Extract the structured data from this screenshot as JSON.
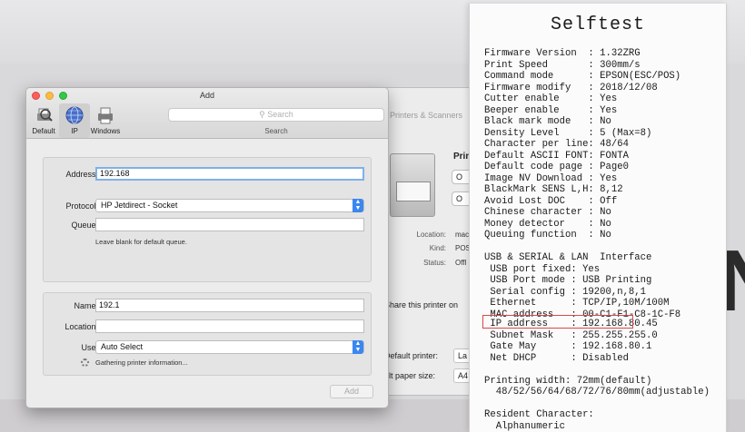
{
  "background_letter": "N",
  "printers_scanners": {
    "title": "Printers & Scanners",
    "printer_name": "Prin",
    "btn1": "O",
    "btn2": "O",
    "rows": [
      {
        "key": "Location:",
        "value": "mac"
      },
      {
        "key": "Kind:",
        "value": "POS"
      },
      {
        "key": "Status:",
        "value": "Offl"
      }
    ],
    "share_text": "Share this printer on",
    "default_printer_label": "Default printer:",
    "default_printer_value": "La",
    "paper_size_label": "ult paper size:",
    "paper_size_value": "A4"
  },
  "add_dialog": {
    "title": "Add",
    "toolbar": [
      {
        "label": "Default",
        "icon": "default-printer-icon"
      },
      {
        "label": "IP",
        "icon": "ip-globe-icon"
      },
      {
        "label": "Windows",
        "icon": "windows-printer-icon"
      }
    ],
    "search_placeholder": "Search",
    "search_caption": "Search",
    "address_label": "Address:",
    "address_value": "192.168",
    "protocol_label": "Protocol:",
    "protocol_value": "HP Jetdirect - Socket",
    "queue_label": "Queue:",
    "queue_value": "",
    "queue_hint": "Leave blank for default queue.",
    "name_label": "Name:",
    "name_value": "192.1",
    "location_label": "Location:",
    "location_value": "",
    "use_label": "Use:",
    "use_value": "Auto Select",
    "status_text": "Gathering printer information...",
    "add_button": "Add"
  },
  "selftest": {
    "title": "Selftest",
    "lines": [
      "Firmware Version  : 1.32ZRG",
      "Print Speed       : 300mm/s",
      "Command mode      : EPSON(ESC/POS)",
      "Firmware modify   : 2018/12/08",
      "Cutter enable     : Yes",
      "Beeper enable     : Yes",
      "Black mark mode   : No",
      "Density Level     : 5 (Max=8)",
      "Character per line: 48/64",
      "Default ASCII FONT: FONTA",
      "Default code page : Page0",
      "Image NV Download : Yes",
      "BlackMark SENS L,H: 8,12",
      "Avoid Lost DOC    : Off",
      "Chinese character : No",
      "Money detector    : No",
      "Queuing function  : No",
      "",
      "USB & SERIAL & LAN  Interface",
      " USB port fixed: Yes",
      " USB Port mode : USB Printing",
      " Serial config : 19200,n,8,1",
      " Ethernet      : TCP/IP,10M/100M",
      " MAC address   : 00-C1-F1-C8-1C-F8",
      " IP address    : 192.168.80.45",
      " Subnet Mask   : 255.255.255.0",
      " Gate May      : 192.168.80.1",
      " Net DHCP      : Disabled",
      "",
      "Printing width: 72mm(default)",
      "  48/52/56/64/68/72/76/80mm(adjustable)",
      "",
      "Resident Character:",
      "  Alphanumeric"
    ]
  }
}
